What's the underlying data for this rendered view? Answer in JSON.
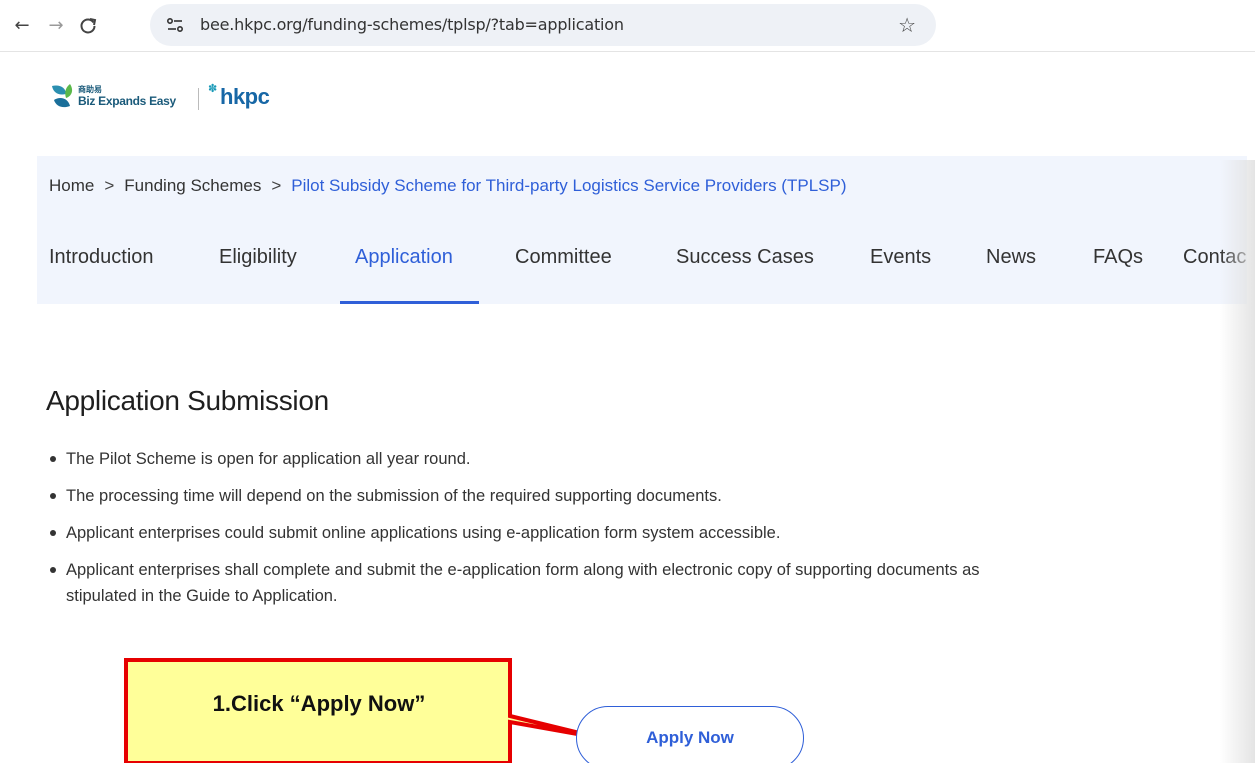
{
  "browser": {
    "url": "bee.hkpc.org/funding-schemes/tplsp/?tab=application",
    "back_icon": "arrow-left-icon",
    "forward_icon": "arrow-right-icon",
    "reload_icon": "reload-icon",
    "site_icon": "site-settings-icon",
    "bookmark_icon": "star-icon"
  },
  "logo": {
    "cn_text": "商助易",
    "en_text": "Biz Expands Easy",
    "hkpc_text": "hkpc"
  },
  "breadcrumb": {
    "items": [
      "Home",
      "Funding Schemes",
      "Pilot Subsidy Scheme for Third-party Logistics Service Providers (TPLSP)"
    ],
    "separator": ">"
  },
  "tabs": [
    {
      "label": "Introduction",
      "active": false
    },
    {
      "label": "Eligibility",
      "active": false
    },
    {
      "label": "Application",
      "active": true
    },
    {
      "label": "Committee",
      "active": false
    },
    {
      "label": "Success Cases",
      "active": false
    },
    {
      "label": "Events",
      "active": false
    },
    {
      "label": "News",
      "active": false
    },
    {
      "label": "FAQs",
      "active": false
    },
    {
      "label": "Contac",
      "active": false
    }
  ],
  "main": {
    "heading": "Application Submission",
    "bullets": [
      "The Pilot Scheme is open for application all year round.",
      "The processing time will depend on the submission of the required supporting documents.",
      "Applicant enterprises could submit online applications using e-application form system accessible.",
      "Applicant enterprises shall complete and submit the e-application form along with electronic copy of supporting documents as",
      "stipulated in the Guide to Application."
    ],
    "apply_button": "Apply Now"
  },
  "callout": {
    "text": "1.Click “Apply Now”"
  },
  "colors": {
    "accent": "#2f5fd8",
    "band": "#f1f5fd",
    "callout_fill": "#ffff99",
    "callout_border": "#e60000"
  }
}
